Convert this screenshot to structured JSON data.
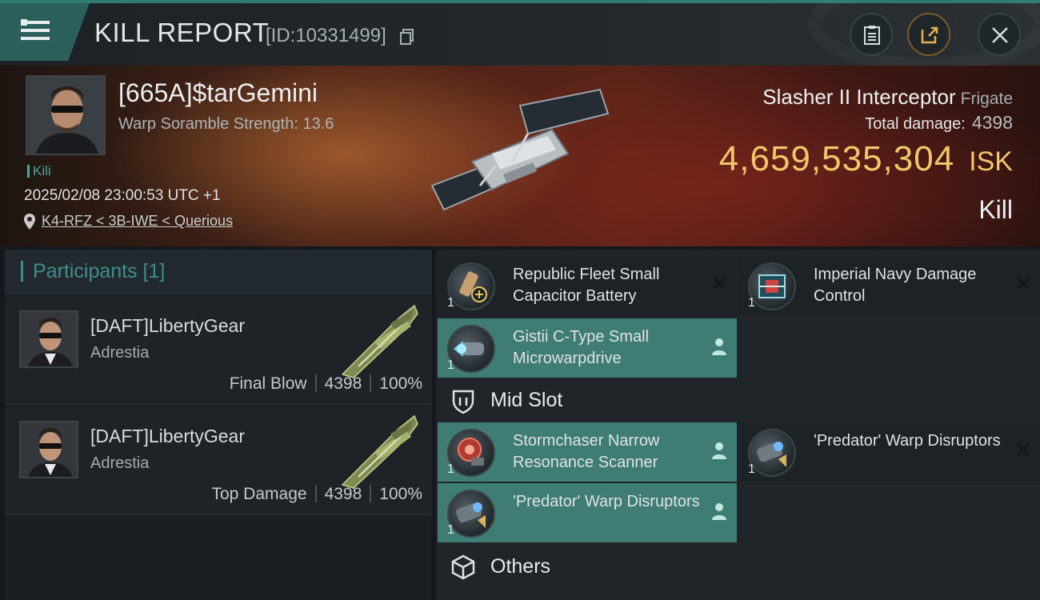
{
  "header": {
    "title": "KILL REPORT",
    "report_id": "[ID:10331499]",
    "icons": [
      "menu-icon",
      "copy-icon",
      "clipboard-icon",
      "share-icon",
      "close-icon"
    ]
  },
  "victim": {
    "name": "[665A]$tarGemini",
    "scramble": "Warp Soramble Strength: 13.6",
    "tag": "Kili",
    "time": "2025/02/08 23:00:53 UTC +1",
    "location": "K4-RFZ < 3B-IWE < Querious",
    "ship_name": "Slasher II Interceptor",
    "ship_class": "Frigate",
    "damage_label": "Total damage:",
    "damage_value": "4398",
    "isk_value": "4,659,535,304",
    "isk_unit": "ISK",
    "result": "Kill"
  },
  "participants": {
    "title": "Participants [1]",
    "rows": [
      {
        "name": "[DAFT]LibertyGear",
        "corp": "Adrestia",
        "role": "Final Blow",
        "damage": "4398",
        "percent": "100%"
      },
      {
        "name": "[DAFT]LibertyGear",
        "corp": "Adrestia",
        "role": "Top Damage",
        "damage": "4398",
        "percent": "100%"
      }
    ]
  },
  "fitting": {
    "modules": [
      {
        "name": "Republic Fleet Small Capacitor Battery",
        "qty": "1",
        "state": "destroyed"
      },
      {
        "name": "Imperial Navy Damage Control",
        "qty": "1",
        "state": "destroyed"
      },
      {
        "name": "Gistii C-Type Small Microwarpdrive",
        "qty": "1",
        "state": "dropped"
      }
    ],
    "mid_slot_label": "Mid Slot",
    "mid_modules": [
      {
        "name": "Stormchaser Narrow Resonance Scanner",
        "qty": "1",
        "state": "dropped"
      },
      {
        "name": "'Predator' Warp Disruptors",
        "qty": "1",
        "state": "destroyed"
      },
      {
        "name": "'Predator' Warp Disruptors",
        "qty": "1",
        "state": "dropped"
      }
    ],
    "others_label": "Others"
  },
  "colors": {
    "accent_teal": "#3f7d74",
    "isk_gold": "#f2c66a",
    "header_bg": "#1c2226"
  }
}
